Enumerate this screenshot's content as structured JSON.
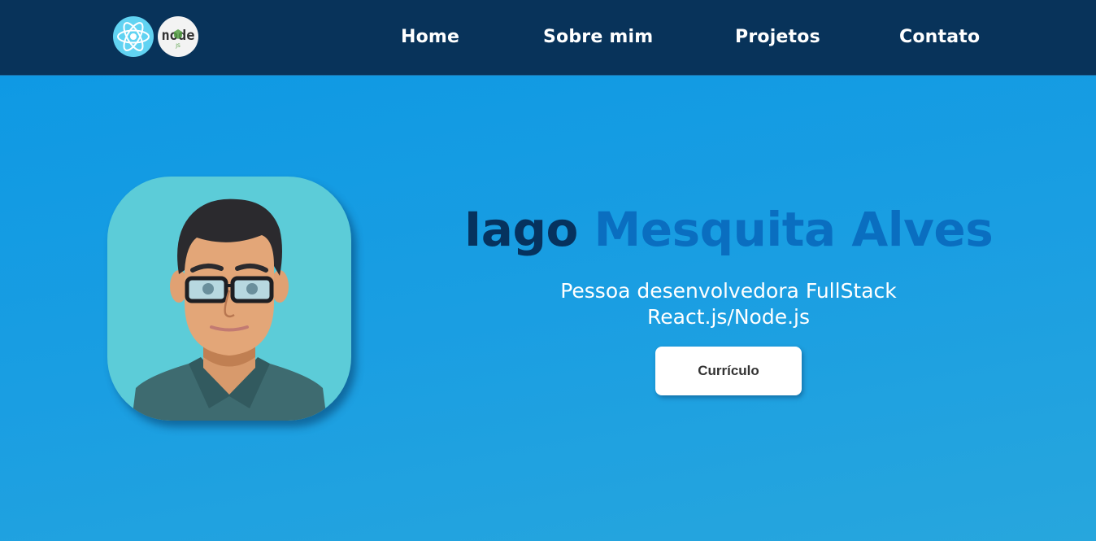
{
  "header": {
    "logos": [
      {
        "name": "react-logo",
        "icon": "react-icon",
        "color": "#61d3f2"
      },
      {
        "name": "node-logo",
        "icon": "nodejs-icon",
        "text": "node",
        "badge": "JS",
        "color": "#539e43"
      }
    ],
    "nav": {
      "home": "Home",
      "about": "Sobre mim",
      "projects": "Projetos",
      "contact": "Contato"
    }
  },
  "hero": {
    "avatar": "developer-avatar-illustration",
    "name_first": "Iago",
    "name_rest": "Mesquita Alves",
    "subtitle_line1": "Pessoa desenvolvedora FullStack",
    "subtitle_line2": "React.js/Node.js",
    "cta_label": "Currículo"
  },
  "colors": {
    "navbar": "#08335a",
    "background": "#0c98e4",
    "name_dark": "#06325e",
    "name_accent": "#0a6ec0",
    "avatar_bg": "#5cccd8"
  }
}
